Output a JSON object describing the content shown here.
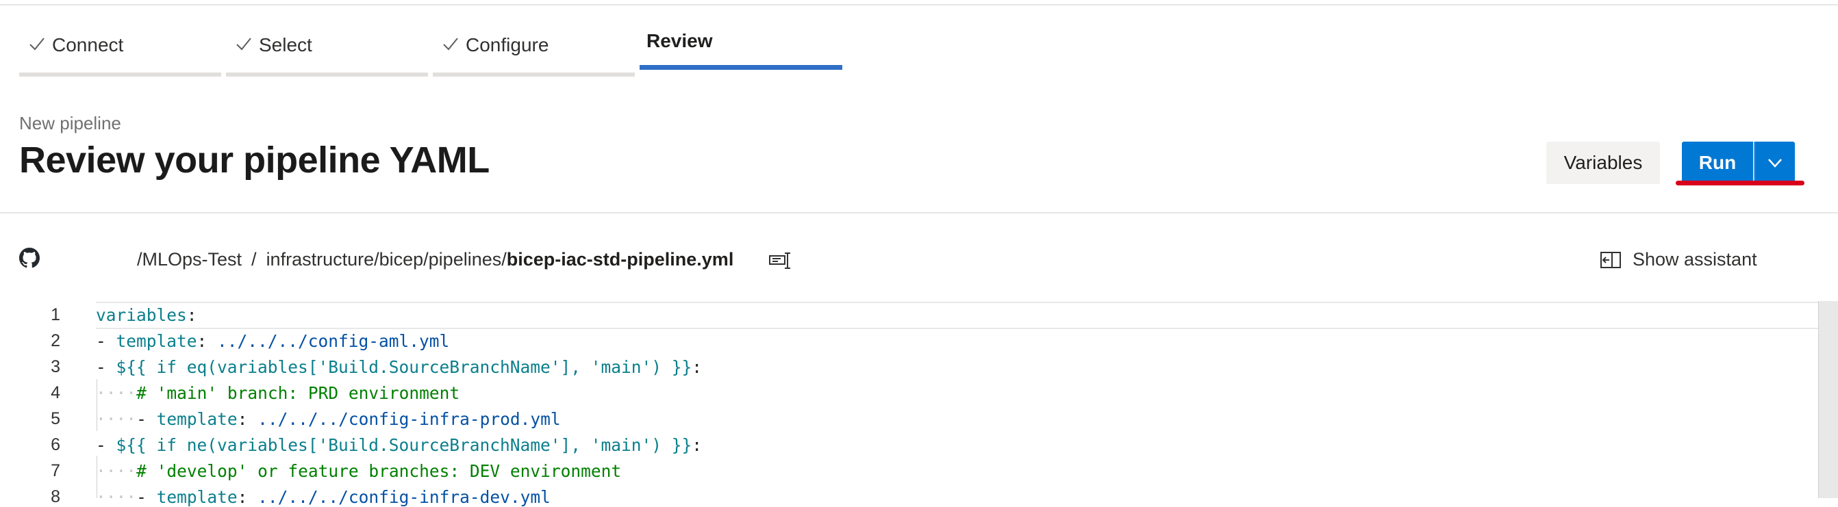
{
  "wizard": {
    "steps": [
      {
        "label": "Connect",
        "done": true
      },
      {
        "label": "Select",
        "done": true
      },
      {
        "label": "Configure",
        "done": true
      },
      {
        "label": "Review",
        "done": false,
        "active": true
      }
    ]
  },
  "header": {
    "kicker": "New pipeline",
    "title": "Review your pipeline YAML",
    "variables_label": "Variables",
    "run_label": "Run"
  },
  "path": {
    "repo": "/MLOps-Test",
    "separator": "/",
    "folder": "infrastructure/bicep/pipelines/",
    "file": "bicep-iac-std-pipeline.yml",
    "assistant_label": "Show assistant"
  },
  "editor": {
    "lines": [
      {
        "n": "1",
        "text": "variables:"
      },
      {
        "n": "2",
        "text": "- template: ../../../config-aml.yml"
      },
      {
        "n": "3",
        "text": "- ${{ if eq(variables['Build.SourceBranchName'], 'main') }}:"
      },
      {
        "n": "4",
        "text": "    # 'main' branch: PRD environment"
      },
      {
        "n": "5",
        "text": "    - template: ../../../config-infra-prod.yml"
      },
      {
        "n": "6",
        "text": "- ${{ if ne(variables['Build.SourceBranchName'], 'main') }}:"
      },
      {
        "n": "7",
        "text": "    # 'develop' or feature branches: DEV environment"
      },
      {
        "n": "8",
        "text": "    - template: ../../../config-infra-dev.yml"
      }
    ]
  },
  "colors": {
    "accent": "#0078d4",
    "active_step": "#2f6fc6",
    "annotation": "#d9001b"
  },
  "icons": [
    "check-icon",
    "chevron-down-icon",
    "github-icon",
    "copy-path-icon",
    "assistant-icon"
  ]
}
